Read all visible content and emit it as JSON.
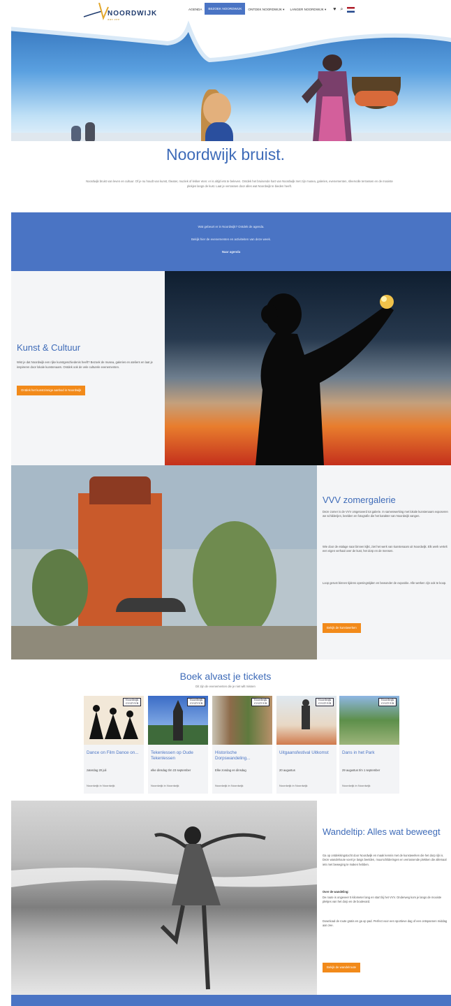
{
  "nav": {
    "logo_text": "NOORDWIJK",
    "logo_subtext": "aan zee",
    "items": [
      {
        "label": "AGENDA"
      },
      {
        "label": "BEZOEK NOORDWIJK"
      },
      {
        "label": "ONTDEK NOORDWIJK ▾"
      },
      {
        "label": "LANGER NOORDWIJK ▾"
      }
    ],
    "heart_icon": "♥",
    "search_icon": "⌕",
    "language": "NL"
  },
  "hero": {
    "headline": "Noordwijk bruist."
  },
  "intro": "Noordwijk bruist van leven en cultuur. Of je nu houdt van kunst, theater, muziek of lekker eten: er is altijd iets te beleven. Ontdek het bruisende hart van Noordwijk met zijn musea, galeries, evenementen, sfeervolle terrassen en de mooiste plekjes langs de kust. Laat je verrassen door alles wat Noordwijk te bieden heeft.",
  "band": {
    "line1": "Wat gebeurt er in Noordwijk? Ontdek de agenda.",
    "line2": "Bekijk hier de evenementen en activiteiten van deze week.",
    "link": "Naar agenda"
  },
  "kunst": {
    "title": "Kunst & Cultuur",
    "text": "Wist je dat Noordwijk een rijke kunstgeschiedenis heeft? Bezoek de musea, galeries en ateliers en laat je inspireren door lokale kunstenaars. Ontdek ook de vele culturele evenementen.",
    "button": "Ontdek het kunstzinnige aanbod in Noordwijk"
  },
  "vvv": {
    "title": "VVV zomergalerie",
    "p1": "Deze zomer is de VVV omgetoverd tot galerie. In samenwerking met lokale kunstenaars exposeren we schilderijen, beelden en fotografie die het karakter van Noordwijk vangen.",
    "p2": "Wie door de etalage naar binnen kijkt, ziet het werk van kunstenaars uit Noordwijk. Elk werk vertelt een eigen verhaal over de kust, het dorp en de mensen.",
    "p3": "Loop gerust binnen tijdens openingstijden en bewonder de expositie. Alle werken zijn ook te koop.",
    "button": "Bekijk de kunstwerken"
  },
  "tickets": {
    "title": "Boek alvast je tickets",
    "subtitle": "Dit zijn de evenementen die je niet wilt missen",
    "cards": [
      {
        "name": "Dance on Film Dance on...",
        "date": "zaterdag 20 juli",
        "location": "Noordwijk in Noordwijk",
        "tag": "Noordwijk CULTUUR"
      },
      {
        "name": "Tekenlessen op Oude Tekenlessen",
        "date": "elke dinsdag t/m 23 september",
        "location": "Noordwijk in Noordwijk",
        "tag": "Noordwijk CULTUUR"
      },
      {
        "name": "Historische Dorpswandeling...",
        "date": "Elke zondag en dinsdag",
        "location": "Noordwijk in Noordwijk",
        "tag": "Noordwijk CULTUUR"
      },
      {
        "name": "Uitgaansfestival Uitkomst",
        "date": "20 augustus",
        "location": "Noordwijk in Noordwijk",
        "tag": "Noordwijk CULTUUR"
      },
      {
        "name": "Dans in het Park",
        "date": "29 augustus t/m 1 september",
        "location": "Noordwijk in Noordwijk",
        "tag": "Noordwijk CULTUUR"
      }
    ]
  },
  "wandel": {
    "title": "Wandeltip: Alles wat beweegt",
    "p1": "Ga op ontdekkingstocht door Noordwijk en maak kennis met de kunstwerken die het dorp rijk is. Deze wandelroute voert je langs beelden, muurschilderingen en verrassende plekken die allemaal iets met beweging te maken hebben.",
    "sub": "Over de wandeling:",
    "p2": "De route is ongeveer 5 kilometer lang en start bij het VVV. Onderweg kom je langs de mooiste plekjes van het dorp en de boulevard.",
    "p3": "Download de route gratis en ga op pad. Perfect voor een sportieve dag of een ontspannen middag aan zee.",
    "button": "Bekijk de wandelroute"
  },
  "colors": {
    "accent_blue": "#4a74c4",
    "title_blue": "#3e6bb8",
    "button_orange": "#f28a1a"
  }
}
